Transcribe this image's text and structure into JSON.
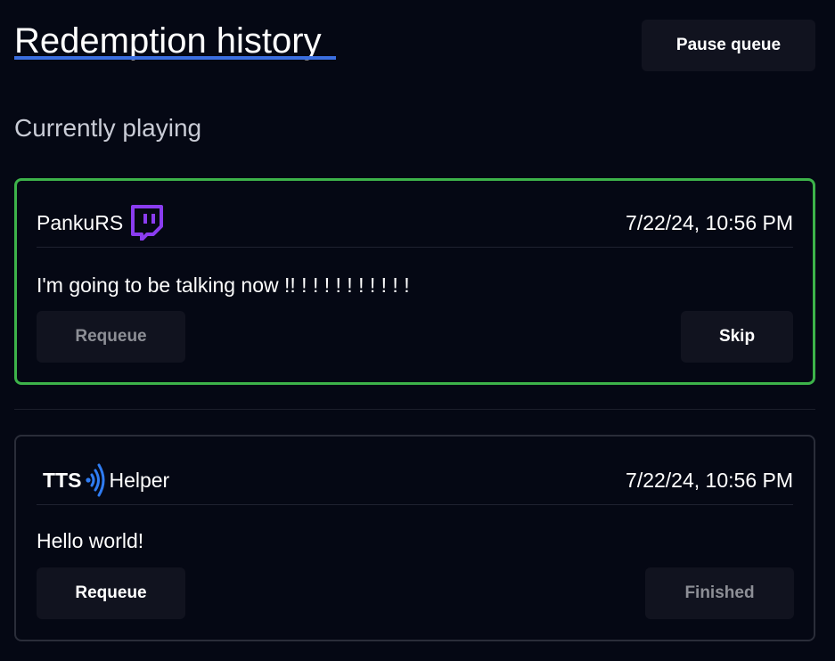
{
  "header": {
    "title": "Redemption history",
    "pause_label": "Pause queue"
  },
  "current": {
    "heading": "Currently playing",
    "username": "PankuRS",
    "platform_icon": "twitch-icon",
    "timestamp": "7/22/24, 10:56 PM",
    "message": "I'm going to be talking now !! ! ! ! ! ! ! ! ! ! !",
    "requeue_label": "Requeue",
    "skip_label": "Skip"
  },
  "history": [
    {
      "brand_left": "TTS",
      "brand_icon": "broadcast-waves-icon",
      "brand_right": "Helper",
      "timestamp": "7/22/24, 10:56 PM",
      "message": "Hello world!",
      "requeue_label": "Requeue",
      "status_label": "Finished"
    }
  ],
  "colors": {
    "background": "#050814",
    "playing_border": "#3db34a",
    "card_border": "#2a2d39",
    "button_bg": "#11131f",
    "accent_blue": "#3b6fe0",
    "twitch_purple": "#8a3cf0"
  }
}
